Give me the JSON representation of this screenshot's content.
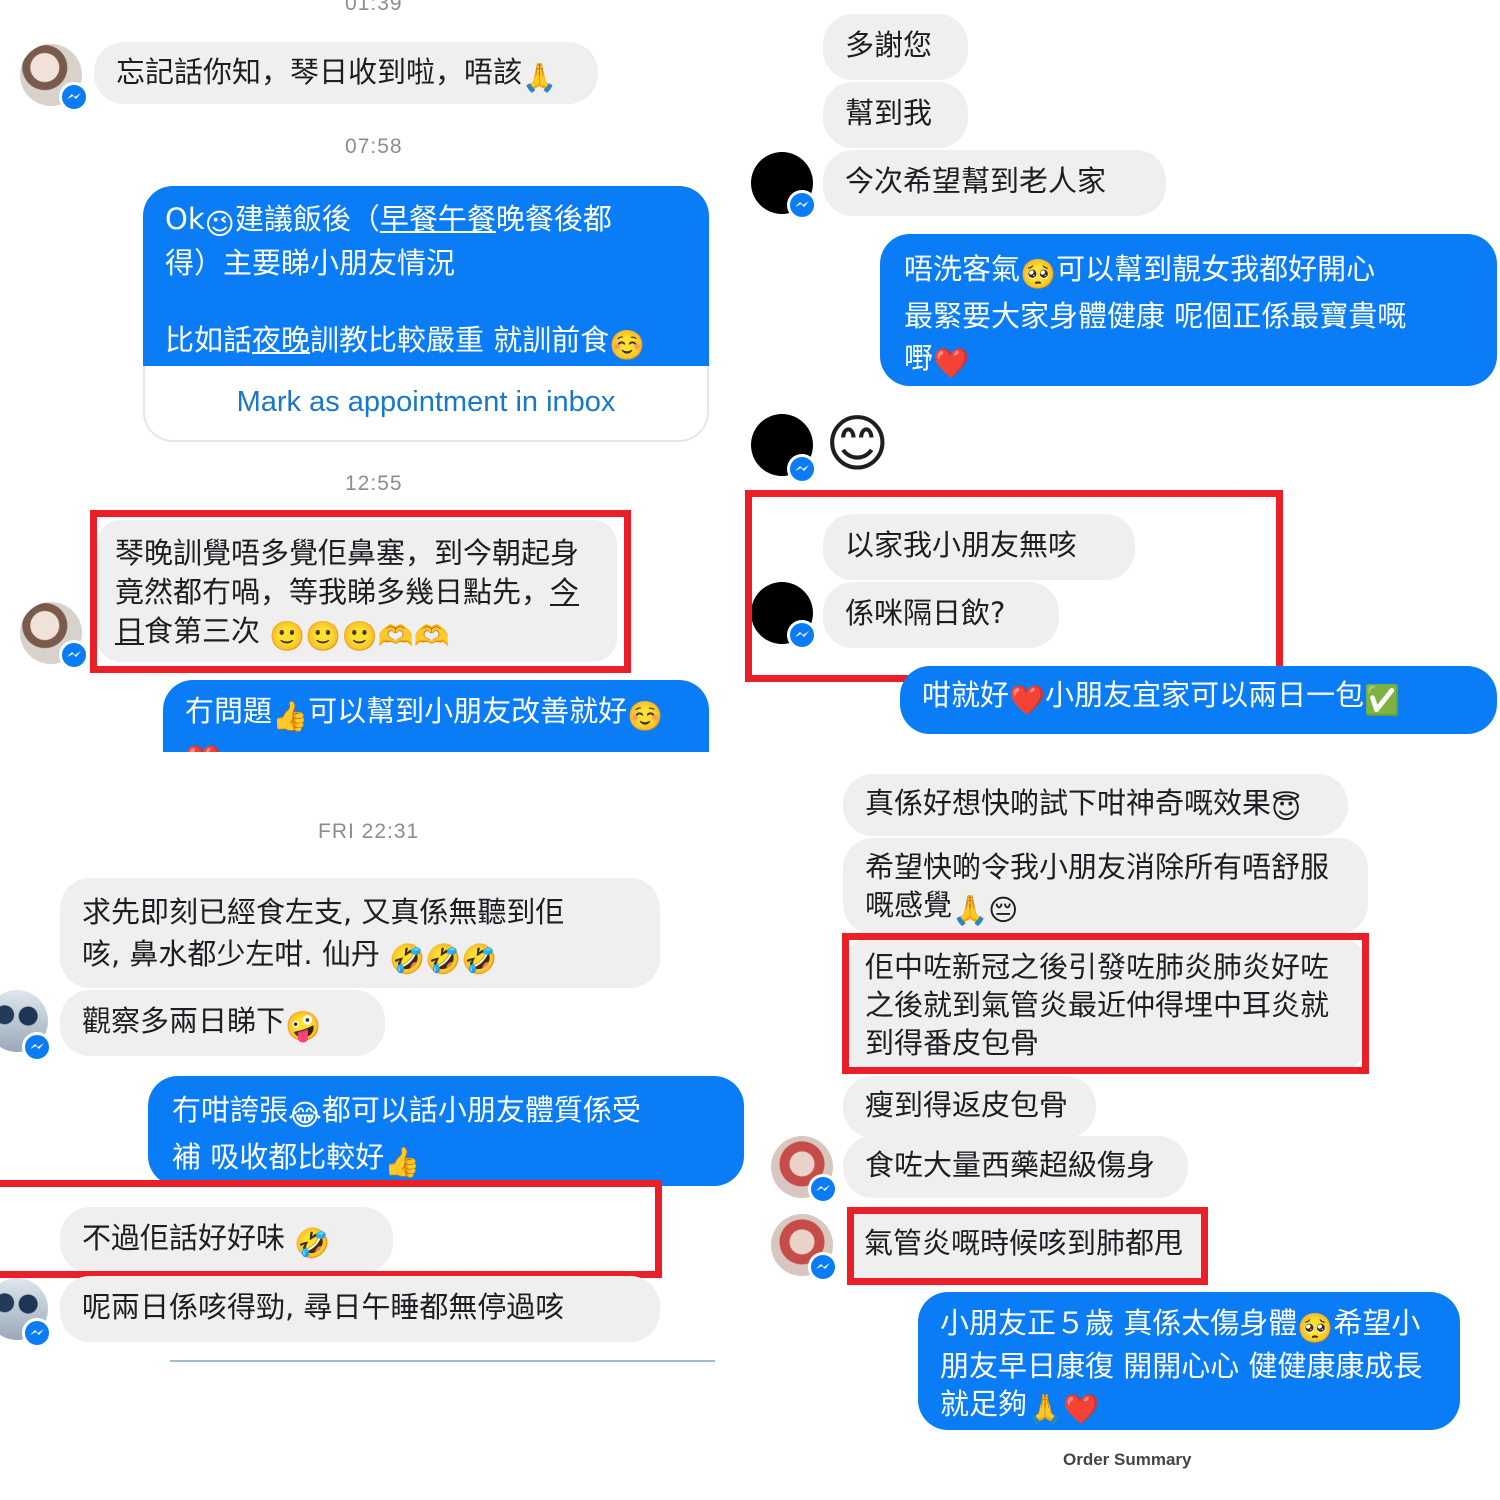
{
  "left": {
    "top_time": "01:39",
    "m1": "忘記話你知，琴日收到啦，唔該",
    "time2": "07:58",
    "m2_line1_a": "Ok",
    "m2_line1_b": "建議飯後（",
    "m2_line1_c": "早餐午餐",
    "m2_line1_d": "晚餐後都",
    "m2_line2": "得）主要睇小朋友情況",
    "m2_line3_a": "比如話",
    "m2_line3_b": "夜晚",
    "m2_line3_c": "訓教比較嚴重 就訓前食",
    "appointment_link": "Mark as appointment in inbox",
    "time3": "12:55",
    "m3_line1": "琴晚訓覺唔多覺佢鼻塞，到今朝起身",
    "m3_line2_a": "竟然都冇喎，等我睇多幾日點先，",
    "m3_line2_b": "今",
    "m3_line3_a": "日",
    "m3_line3_b": "食第三次",
    "m4": "冇問題",
    "m4_b": "可以幫到小朋友改善就好",
    "time4": "FRI 22:31",
    "m5_line1": "求先即刻已經食左支, 又真係無聽到佢",
    "m5_line2": "咳, 鼻水都少左咁. 仙丹",
    "m6": "觀察多兩日睇下",
    "m7_line1_a": "冇咁誇張",
    "m7_line1_b": "都可以話小朋友體質係受",
    "m7_line2": "補 吸收都比較好",
    "m8": "不過佢話好好味",
    "m9": "呢兩日係咳得勁, 尋日午睡都無停過咳"
  },
  "right": {
    "r1": "多謝您",
    "r2": "幫到我",
    "r3": "今次希望幫到老人家",
    "r4_line1_a": "唔洗客氣",
    "r4_line1_b": "可以幫到靚女我都好開心",
    "r4_line2": "最緊要大家身體健康 呢個正係最寶貴嘅",
    "r4_line3": "嘢",
    "r5": "以家我小朋友無咳",
    "r6": "係咪隔日飲?",
    "r7_a": "咁就好",
    "r7_b": "小朋友宜家可以兩日一包",
    "r8": "真係好想快啲試下咁神奇嘅效果",
    "r9_line1": "希望快啲令我小朋友消除所有唔舒服",
    "r9_line2": "嘅感覺",
    "r10_line1": "佢中咗新冠之後引發咗肺炎肺炎好咗",
    "r10_line2": "之後就到氣管炎最近仲得埋中耳炎就",
    "r10_line3": "到得番皮包骨",
    "r11": "瘦到得返皮包骨",
    "r12": "食咗大量西藥超級傷身",
    "r13": "氣管炎嘅時候咳到肺都甩",
    "r14_line1_a": "小朋友正５歲 真係太傷身體",
    "r14_line1_b": "希望小",
    "r14_line2": "朋友早日康復 開開心心 健健康康成長",
    "r14_line3": "就足夠",
    "footer": "Order Summary"
  },
  "colors": {
    "outgoing_bubble": "#0a7cf6",
    "incoming_bubble": "#efeff0",
    "highlight_box": "#ea1f27",
    "link": "#1877c9",
    "timestamp": "#8a8d91"
  },
  "icons": [
    "messenger-badge-icon",
    "pray-emoji",
    "wink-emoji",
    "blush-emoji",
    "smile-emoji",
    "heart-hands-emoji",
    "thumbs-up-emoji",
    "heart-emoji",
    "pleading-emoji",
    "rofl-emoji",
    "zany-emoji",
    "joy-emoji",
    "check-mark-emoji",
    "innocent-emoji",
    "pensive-emoji"
  ]
}
